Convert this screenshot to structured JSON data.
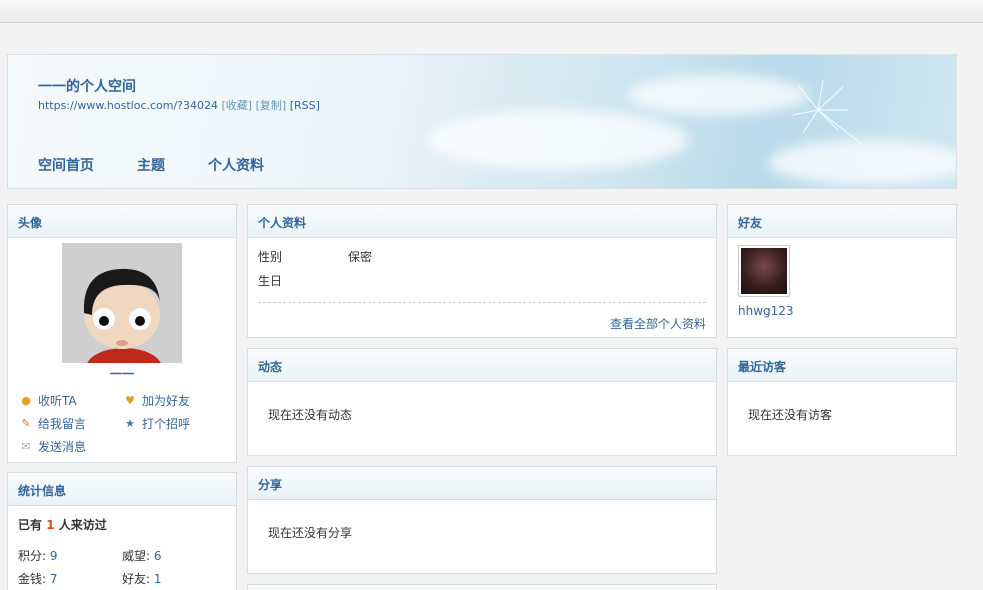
{
  "space": {
    "title": "一一的个人空间",
    "url": "https://www.hostloc.com/?34024",
    "links": {
      "fav": "[收藏]",
      "copy": "[复制]",
      "rss": "[RSS]"
    },
    "nav": [
      "空间首页",
      "主题",
      "个人资料"
    ]
  },
  "avatar_box": {
    "title": "头像",
    "username": "一一",
    "actions": {
      "follow": "收听TA",
      "add_friend": "加为好友",
      "leave_message": "给我留言",
      "greet": "打个招呼",
      "send_message": "发送消息"
    }
  },
  "stats_box": {
    "title": "统计信息",
    "visit_prefix": "已有",
    "visit_count": "1",
    "visit_suffix": "人来访过",
    "items": [
      {
        "label": "积分: ",
        "value": "9"
      },
      {
        "label": "威望: ",
        "value": "6"
      },
      {
        "label": "金钱: ",
        "value": "7"
      },
      {
        "label": "好友: ",
        "value": "1"
      }
    ]
  },
  "profile_box": {
    "title": "个人资料",
    "rows": [
      {
        "label": "性别",
        "value": "保密"
      },
      {
        "label": "生日",
        "value": ""
      }
    ],
    "more": "查看全部个人资料"
  },
  "feed_box": {
    "title": "动态",
    "empty": "现在还没有动态"
  },
  "share_box": {
    "title": "分享",
    "empty": "现在还没有分享"
  },
  "friends_box": {
    "title": "好友",
    "friend_name": "hhwg123"
  },
  "visitors_box": {
    "title": "最近访客",
    "empty": "现在还没有访客"
  },
  "colors": {
    "link": "#336699",
    "highlight": "#e04a1a",
    "border": "#d7dde2"
  }
}
